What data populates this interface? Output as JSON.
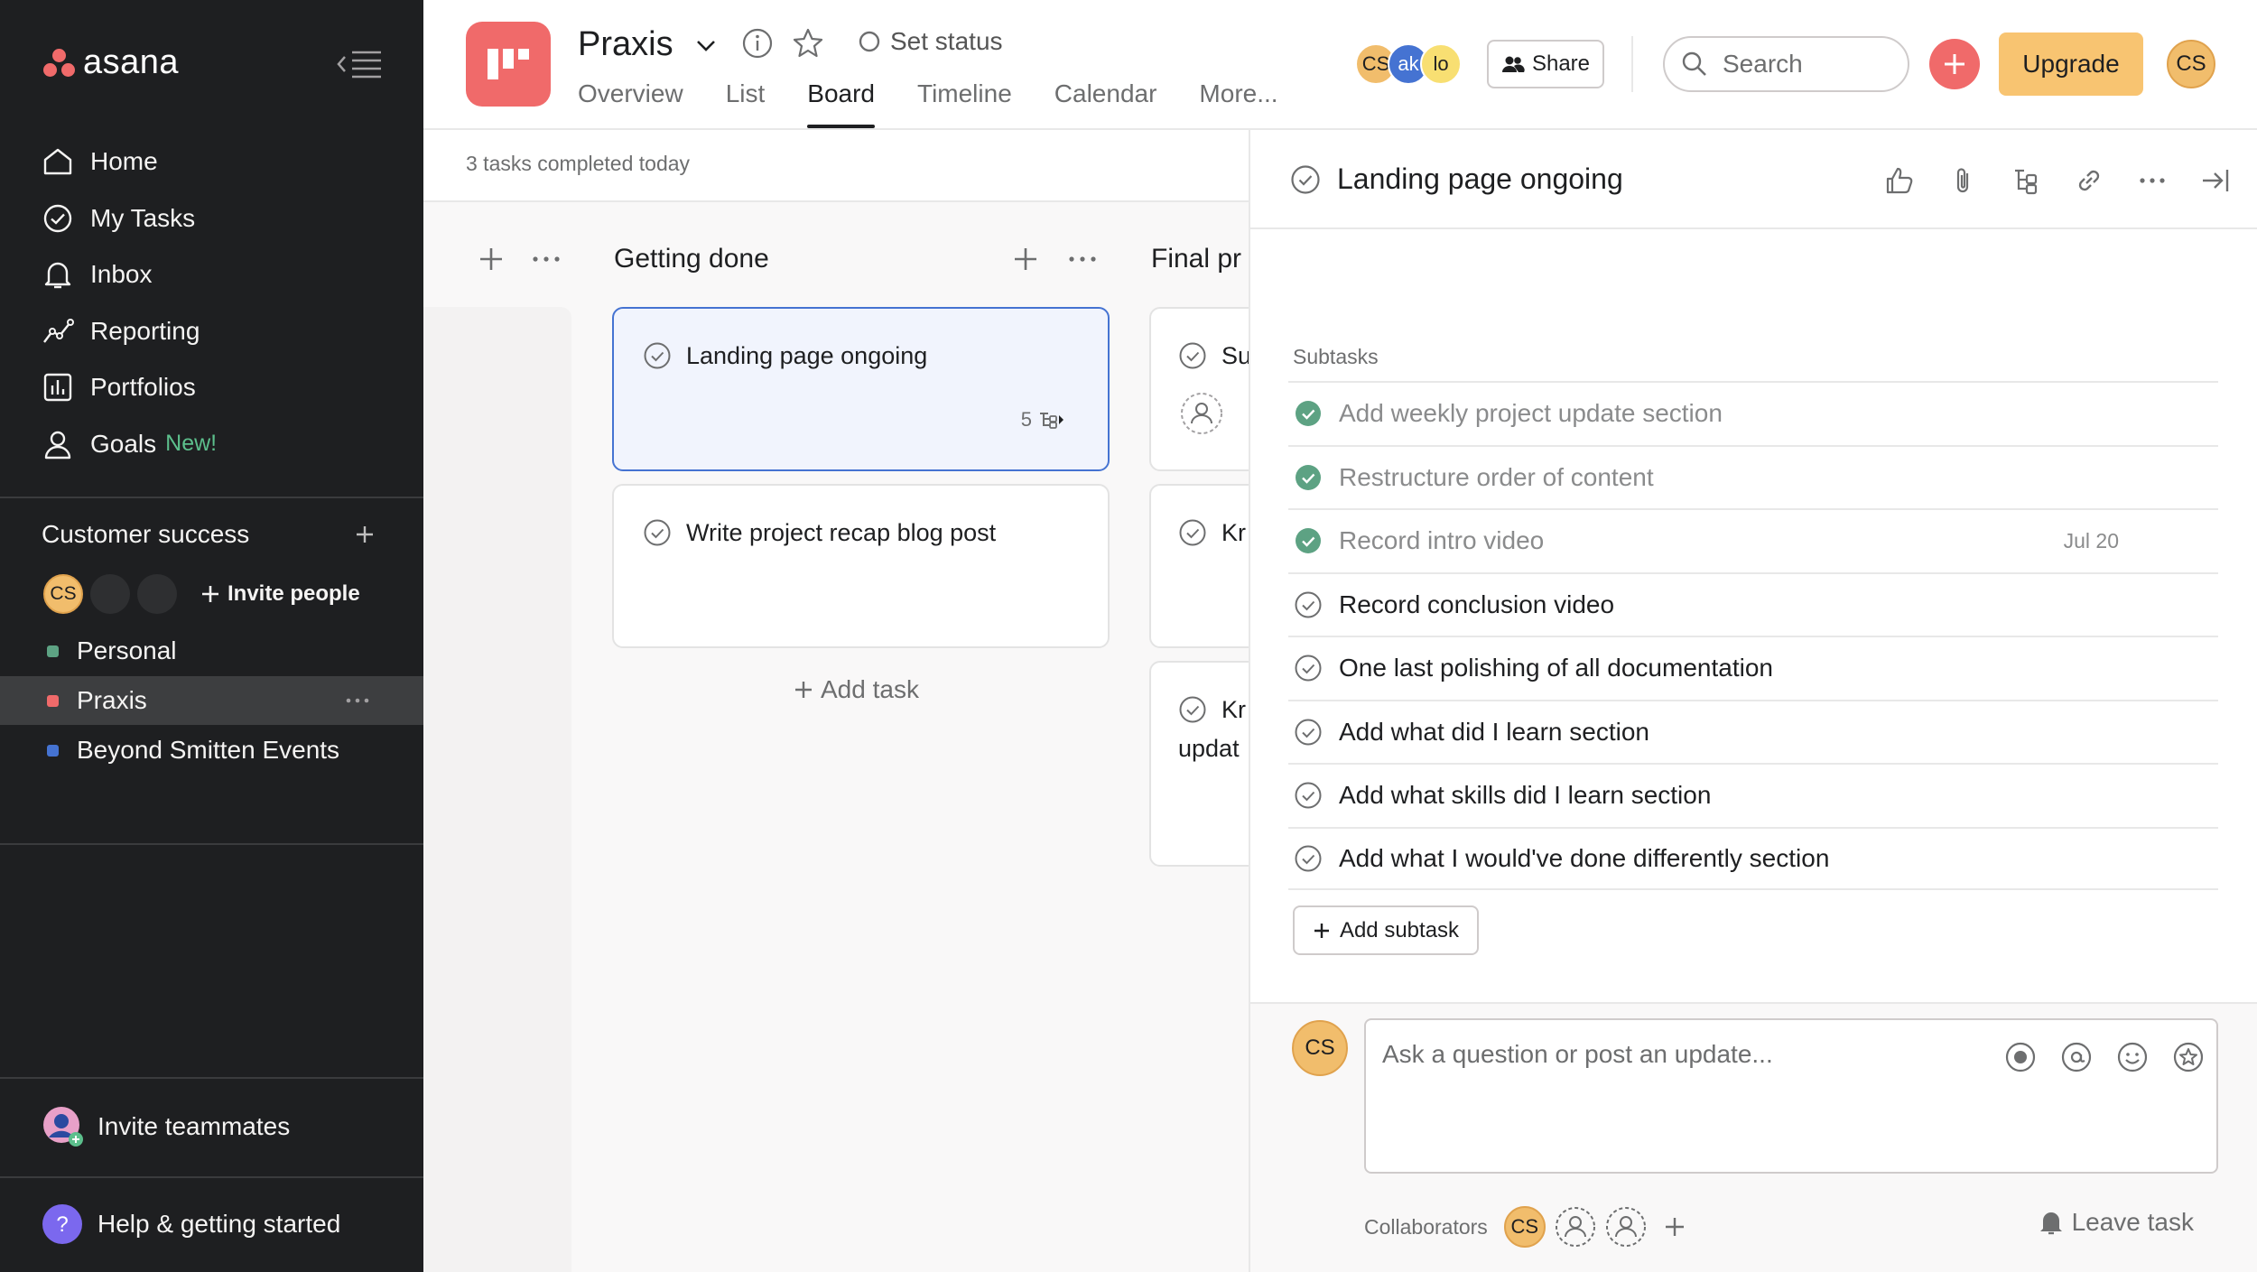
{
  "sidebar": {
    "brand": "asana",
    "nav": [
      {
        "label": "Home",
        "icon": "home-icon"
      },
      {
        "label": "My Tasks",
        "icon": "check-circle-icon"
      },
      {
        "label": "Inbox",
        "icon": "bell-icon"
      },
      {
        "label": "Reporting",
        "icon": "chart-line-icon"
      },
      {
        "label": "Portfolios",
        "icon": "bar-chart-icon"
      },
      {
        "label": "Goals",
        "icon": "person-icon",
        "badge": "New!"
      }
    ],
    "team": {
      "name": "Customer success",
      "member_initials": "CS",
      "invite_label": "Invite people"
    },
    "projects": [
      {
        "label": "Personal",
        "color": "#5da283"
      },
      {
        "label": "Praxis",
        "color": "#f06a6a",
        "active": true
      },
      {
        "label": "Beyond Smitten Events",
        "color": "#4573d2"
      }
    ],
    "invite_teammates": "Invite teammates",
    "help": "Help & getting started"
  },
  "header": {
    "project_title": "Praxis",
    "set_status": "Set status",
    "tabs": [
      {
        "label": "Overview"
      },
      {
        "label": "List"
      },
      {
        "label": "Board",
        "active": true
      },
      {
        "label": "Timeline"
      },
      {
        "label": "Calendar"
      },
      {
        "label": "More..."
      }
    ],
    "members": [
      {
        "initials": "CS",
        "color": "#f1bd6c"
      },
      {
        "initials": "ak",
        "color": "#4573d2"
      },
      {
        "initials": "lo",
        "color": "#f8df72"
      }
    ],
    "share_label": "Share",
    "search_placeholder": "Search",
    "upgrade_label": "Upgrade",
    "user_initials": "CS"
  },
  "board": {
    "completed_text": "3 tasks completed today",
    "columns": [
      {
        "title": "Getting done",
        "cards": [
          {
            "title": "Landing page ongoing",
            "subtask_count": "5",
            "selected": true
          },
          {
            "title": "Write project recap blog post"
          }
        ],
        "add_task": "Add task"
      },
      {
        "title": "Final pr",
        "cards": [
          {
            "title": "Su"
          },
          {
            "title": "Kr"
          },
          {
            "title": "Kr",
            "line2": "updat"
          }
        ]
      }
    ]
  },
  "detail": {
    "title": "Landing page ongoing",
    "subtasks_label": "Subtasks",
    "subtasks": [
      {
        "label": "Add weekly project update section",
        "done": true
      },
      {
        "label": "Restructure order of content",
        "done": true
      },
      {
        "label": "Record intro video",
        "done": true,
        "date": "Jul 20"
      },
      {
        "label": "Record conclusion video",
        "done": false
      },
      {
        "label": "One last polishing of all documentation",
        "done": false
      },
      {
        "label": "Add what did I learn section",
        "done": false
      },
      {
        "label": "Add what skills did I learn section",
        "done": false
      },
      {
        "label": "Add what I would've done differently section",
        "done": false
      }
    ],
    "add_subtask": "Add subtask",
    "comment_avatar": "CS",
    "comment_placeholder": "Ask a question or post an update...",
    "collaborators_label": "Collaborators",
    "collaborator_initials": "CS",
    "leave_task": "Leave task"
  }
}
